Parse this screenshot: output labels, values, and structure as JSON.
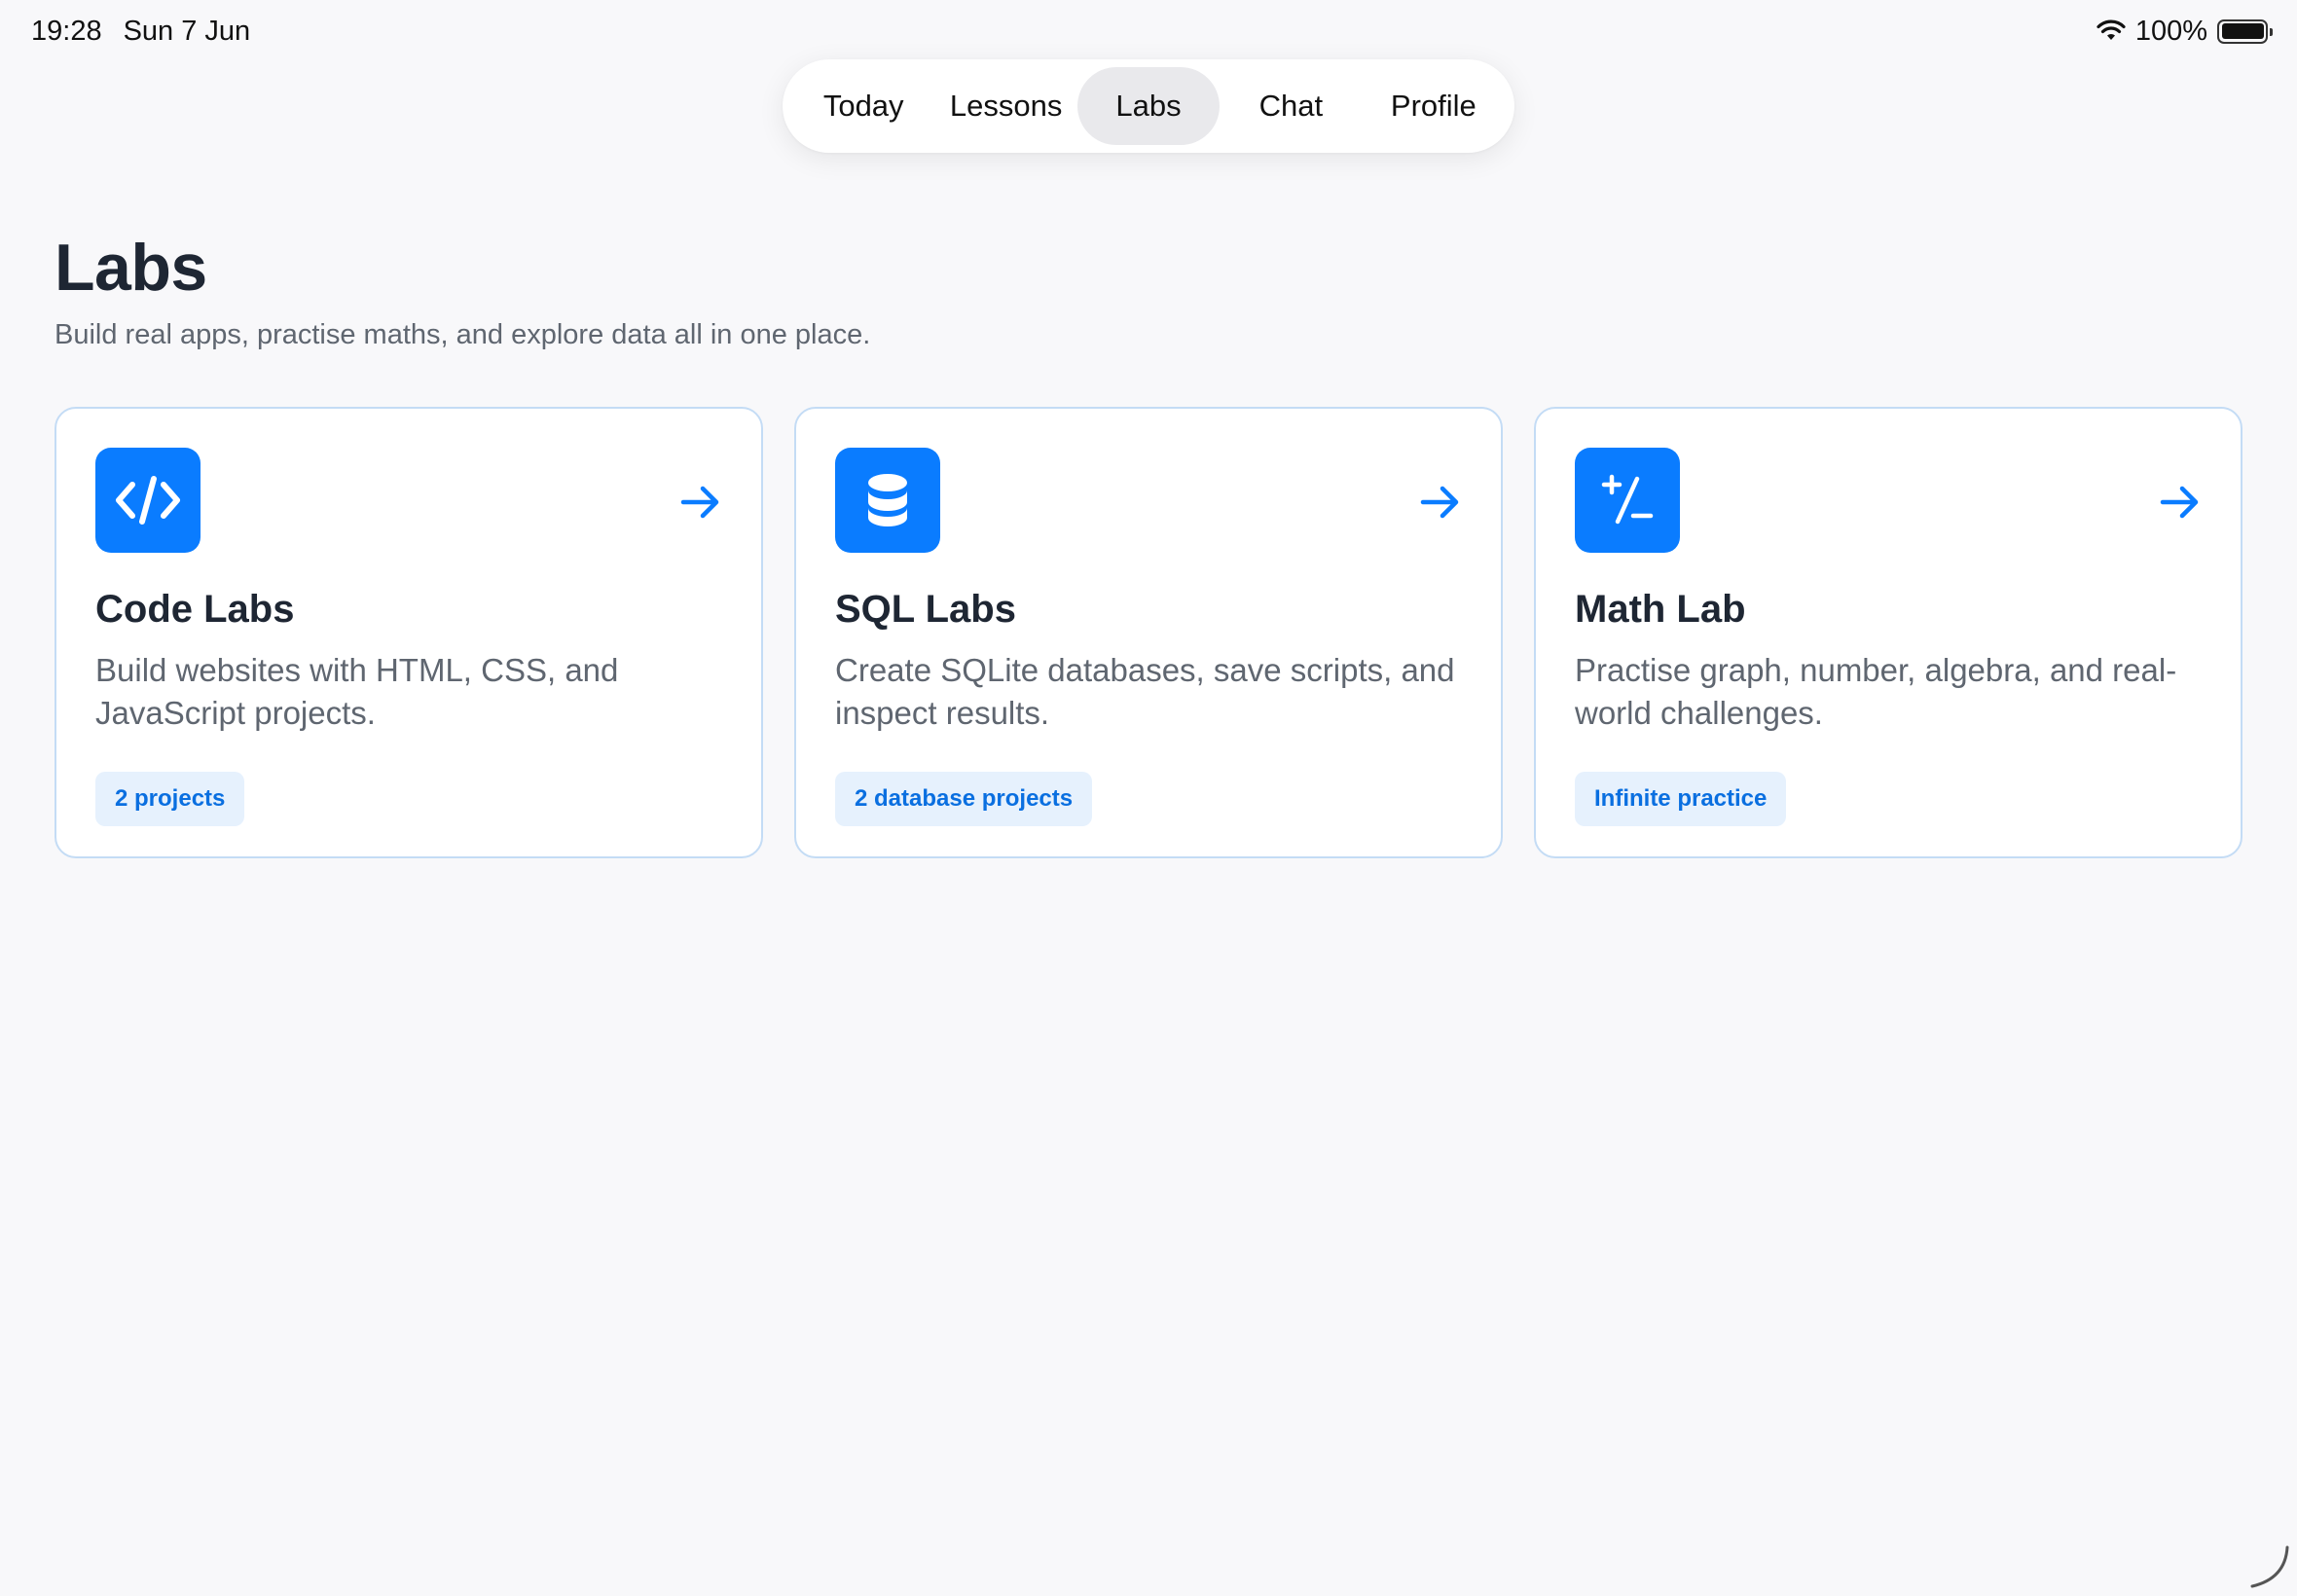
{
  "status_bar": {
    "time": "19:28",
    "date": "Sun 7 Jun",
    "battery_percent": "100%",
    "battery_level": 1.0
  },
  "tabs": [
    {
      "label": "Today",
      "active": false
    },
    {
      "label": "Lessons",
      "active": false
    },
    {
      "label": "Labs",
      "active": true
    },
    {
      "label": "Chat",
      "active": false
    },
    {
      "label": "Profile",
      "active": false
    }
  ],
  "page": {
    "title": "Labs",
    "subtitle": "Build real apps, practise maths, and explore data all in one place."
  },
  "cards": [
    {
      "title": "Code Labs",
      "description": "Build websites with HTML, CSS, and JavaScript projects.",
      "badge": "2 projects",
      "icon": "code-icon"
    },
    {
      "title": "SQL Labs",
      "description": "Create SQLite databases, save scripts, and inspect results.",
      "badge": "2 database projects",
      "icon": "database-icon"
    },
    {
      "title": "Math Lab",
      "description": "Practise graph, number, algebra, and real-world challenges.",
      "badge": "Infinite practice",
      "icon": "plus-minus-icon"
    }
  ],
  "colors": {
    "accent": "#0a7cff",
    "badge_bg": "#e6f1fd",
    "card_border": "#c4dcf5",
    "background": "#f8f8fa"
  }
}
